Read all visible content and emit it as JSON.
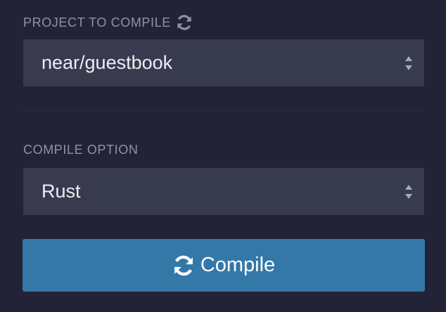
{
  "project_section": {
    "label": "PROJECT TO COMPILE",
    "refresh_icon": "refresh-icon",
    "selected_value": "near/guestbook"
  },
  "option_section": {
    "label": "COMPILE OPTION",
    "selected_value": "Rust"
  },
  "compile_button": {
    "label": "Compile",
    "icon": "refresh-icon"
  },
  "colors": {
    "background": "#222336",
    "select_background": "#383a4e",
    "label_text": "#8d93a6",
    "select_text": "#ecedf3",
    "button_background": "#3478a8",
    "button_text": "#ffffff"
  }
}
